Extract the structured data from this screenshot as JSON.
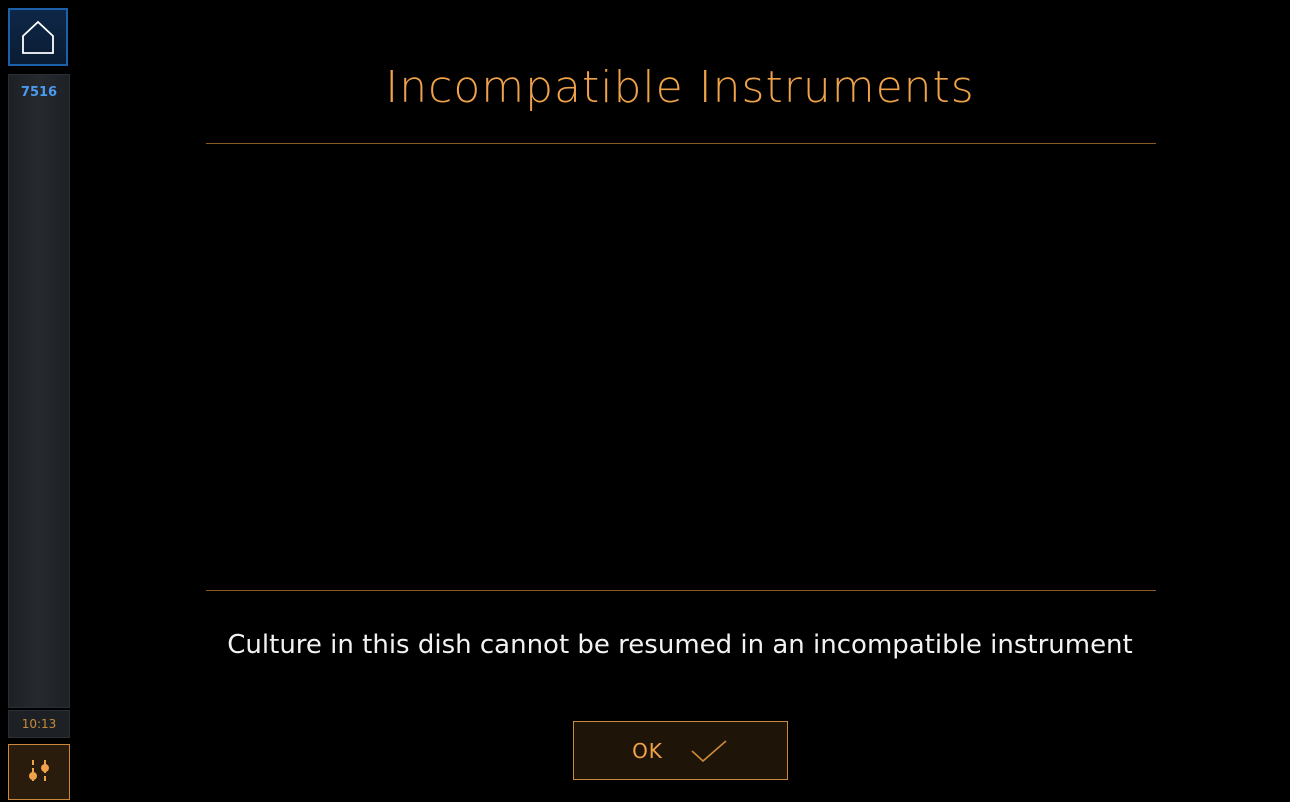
{
  "sidebar": {
    "home_icon": "home-icon",
    "dish_id": "7516",
    "clock": "10:13",
    "settings_icon": "sliders-icon"
  },
  "dialog": {
    "title": "Incompatible Instruments",
    "message": "Culture in this dish cannot be resumed in an incompatible instrument",
    "ok_label": "OK",
    "ok_icon": "checkmark-icon"
  },
  "colors": {
    "accent": "#f0a24a",
    "divider": "#8a5a24",
    "home_border": "#1d5fa8",
    "dish_id": "#4a9bf0"
  }
}
